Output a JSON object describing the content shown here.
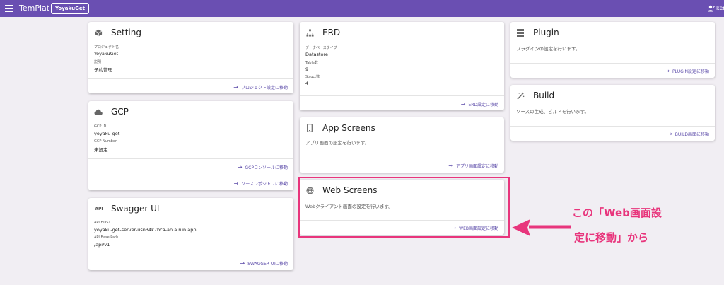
{
  "topbar": {
    "app_title": "TemPlat",
    "project_chip": "YoyakuGet",
    "user_name": "ken"
  },
  "cards": {
    "setting": {
      "title": "Setting",
      "fields": [
        {
          "label": "プロジェクト名",
          "value": "YoyakuGet"
        },
        {
          "label": "説明",
          "value": "予約管理"
        }
      ],
      "action": "プロジェクト設定に移動"
    },
    "gcp": {
      "title": "GCP",
      "fields": [
        {
          "label": "GCP ID",
          "value": "yoyaku-get"
        },
        {
          "label": "GCP Number",
          "value": "未設定"
        }
      ],
      "action1": "GCPコンソールに移動",
      "action2": "ソースレポジトリに移動"
    },
    "swagger": {
      "title": "Swagger UI",
      "fields": [
        {
          "label": "API HOST",
          "value": "yoyaku-get-server-usn34k7bca-an.a.run.app"
        },
        {
          "label": "API Base Path",
          "value": "/api/v1"
        }
      ],
      "action": "SWAGGER UIに移動"
    },
    "erd": {
      "title": "ERD",
      "fields": [
        {
          "label": "データベースタイプ",
          "value": "Datastore"
        },
        {
          "label": "Table数",
          "value": "9"
        },
        {
          "label": "Struct数",
          "value": "4"
        }
      ],
      "action": "ERD設定に移動"
    },
    "app_screens": {
      "title": "App Screens",
      "desc": "アプリ画面の設定を行います。",
      "action": "アプリ画面設定に移動"
    },
    "web_screens": {
      "title": "Web Screens",
      "desc": "Webクライアント画面の設定を行います。",
      "action": "WEB画面設定に移動"
    },
    "plugin": {
      "title": "Plugin",
      "desc": "プラグインの設定を行います。",
      "action": "PLUGIN設定に移動"
    },
    "build": {
      "title": "Build",
      "desc": "ソースの生成、ビルドを行います。",
      "action": "BUILD画面に移動"
    }
  },
  "api_badge": "API",
  "annotation": {
    "line1": "この「Web画面設",
    "line2": "定に移動」から"
  },
  "colors": {
    "topbar": "#6a4fb2",
    "accent": "#5a49a8",
    "highlight": "#e8357c"
  }
}
